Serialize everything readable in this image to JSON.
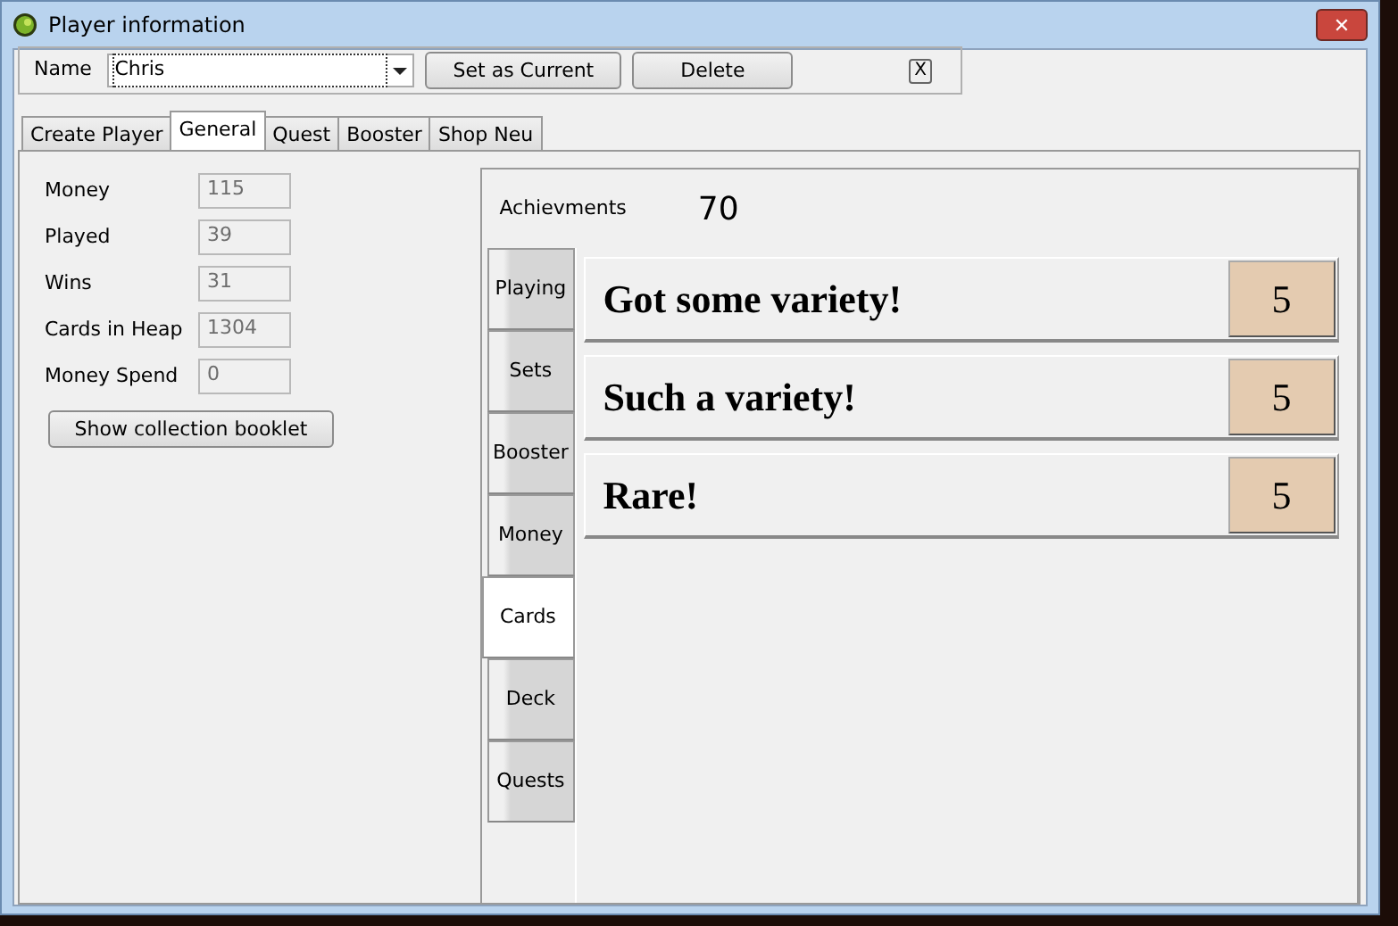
{
  "window": {
    "title": "Player information",
    "close": "✕"
  },
  "toolbar": {
    "name_label": "Name",
    "name_value": "Chris",
    "buttons": [
      "Set as Current",
      "Delete"
    ],
    "close": "X"
  },
  "tabs": [
    {
      "label": "Create Player",
      "selected": false
    },
    {
      "label": "General",
      "selected": true
    },
    {
      "label": "Quest",
      "selected": false
    },
    {
      "label": "Booster",
      "selected": false
    },
    {
      "label": "Shop Neu",
      "selected": false
    }
  ],
  "stats": [
    {
      "label": "Money",
      "value": "115"
    },
    {
      "label": "Played",
      "value": "39"
    },
    {
      "label": "Wins",
      "value": "31"
    },
    {
      "label": "Cards in Heap",
      "value": "1304"
    },
    {
      "label": "Money Spend",
      "value": "0"
    }
  ],
  "booklet_button": "Show collection booklet",
  "achievements": {
    "label": "Achievments",
    "total": "70",
    "categories": [
      {
        "label": "Playing",
        "selected": false
      },
      {
        "label": "Sets",
        "selected": false
      },
      {
        "label": "Booster",
        "selected": false
      },
      {
        "label": "Money",
        "selected": false
      },
      {
        "label": "Cards",
        "selected": true
      },
      {
        "label": "Deck",
        "selected": false
      },
      {
        "label": "Quests",
        "selected": false
      }
    ],
    "items": [
      {
        "title": "Got some variety!",
        "points": "5"
      },
      {
        "title": "Such a variety!",
        "points": "5"
      },
      {
        "title": "Rare!",
        "points": "5"
      }
    ]
  }
}
